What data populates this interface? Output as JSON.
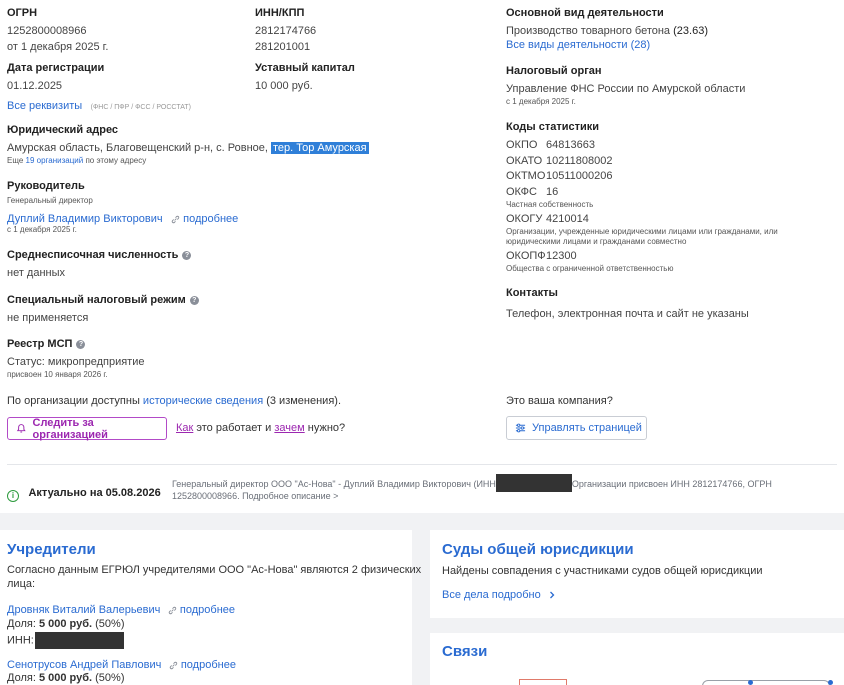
{
  "company": {
    "ogrn_label": "ОГРН",
    "ogrn": "1252800008966",
    "ogrn_date": "от 1 декабря 2025 г.",
    "inn_label": "ИНН/КПП",
    "inn": "2812174766",
    "kpp": "281201001",
    "reg_label": "Дата регистрации",
    "reg_date": "01.12.2025",
    "capital_label": "Уставный капитал",
    "capital": "10 000 руб.",
    "all_req_link": "Все реквизиты",
    "all_req_note": "(ФНС / ПФР / ФСС / РОССТАТ)",
    "address_label": "Юридический адрес",
    "address_main": "Амурская область, Благовещенский р-н, с. Ровное, ",
    "address_highlight": "тер. Тор Амурская",
    "address_note_pre": "Еще ",
    "address_note_link": "19 организаций",
    "address_note_post": " по этому адресу",
    "head_label": "Руководитель",
    "head_role": "Генеральный директор",
    "head_name": "Дуплий Владимир Викторович",
    "head_more": "подробнее",
    "head_date": "с 1 декабря 2025 г.",
    "staff_label": "Среднесписочная численность",
    "staff_value": "нет данных",
    "tax_label": "Специальный налоговый режим",
    "tax_value": "не применяется",
    "msp_label": "Реестр МСП",
    "msp_status": "Статус: микропредприятие",
    "msp_date": "присвоен 10 января 2026 г.",
    "history_pre": "По организации доступны ",
    "history_link": "исторические сведения",
    "history_post": " (3 изменения).",
    "follow_btn": "Следить за организацией",
    "how_link": "Как",
    "how_mid": " это работает и ",
    "why_link": "зачем",
    "why_post": " нужно?"
  },
  "right": {
    "activity_label": "Основной вид деятельности",
    "activity_value": "Производство товарного бетона",
    "activity_code": "(23.63)",
    "activity_all": "Все виды деятельности (28)",
    "tax_org_label": "Налоговый орган",
    "tax_org_value": "Управление ФНС России по Амурской области",
    "tax_org_date": "с 1 декабря 2025 г.",
    "stat_label": "Коды статистики",
    "okpo_k": "ОКПО",
    "okpo_v": "64813663",
    "okato_k": "ОКАТО",
    "okato_v": "10211808002",
    "oktmo_k": "ОКТМО",
    "oktmo_v": "10511000206",
    "okfs_k": "ОКФС",
    "okfs_v": "16",
    "okfs_note": "Частная собственность",
    "okogu_k": "ОКОГУ",
    "okogu_v": "4210014",
    "okogu_note1": "Организации, учрежденные юридическими лицами или гражданами, или",
    "okogu_note2": "юридическими лицами и гражданами совместно",
    "okopf_k": "ОКОПФ",
    "okopf_v": "12300",
    "okopf_note": "Общества с ограниченной ответственностью",
    "contacts_label": "Контакты",
    "contacts_value": "Телефон, электронная почта и сайт не указаны",
    "own_q": "Это ваша компания?",
    "manage_btn": "Управлять страницей"
  },
  "actual": {
    "label": "Актуально на 05.08.2026",
    "desc1_pre": "Генеральный директор ООО \"Ас-Нова\" - Дуплий Владимир Викторович (ИНН",
    "desc1_post": "Организации присвоен ИНН 2812174766, ОГРН",
    "desc2": "1252800008966. Подробное описание >"
  },
  "founders": {
    "title": "Учредители",
    "text1": "Согласно данным ЕГРЮЛ учредителями ООО \"Ас-Нова\" являются 2 физических",
    "text2": "лица:",
    "f1_name": "Дровняк Виталий Валерьевич",
    "f1_more": "подробнее",
    "f1_share_pre": "Доля: ",
    "f1_share": "5 000 руб.",
    "f1_pct": " (50%)",
    "f1_inn": "ИНН:",
    "f2_name": "Сенотрусов Андрей Павлович",
    "f2_more": "подробнее",
    "f2_share_pre": "Доля: ",
    "f2_share": "5 000 руб.",
    "f2_pct": " (50%)"
  },
  "courts": {
    "title": "Суды общей юрисдикции",
    "text": "Найдены совпадения с участниками судов общей юрисдикции",
    "link": "Все дела подробно"
  },
  "links": {
    "title": "Связи"
  }
}
